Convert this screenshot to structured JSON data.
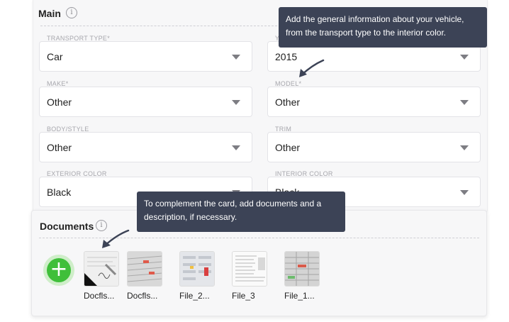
{
  "main": {
    "title": "Main",
    "fields": [
      {
        "label": "TRANSPORT TYPE*",
        "value": "Car"
      },
      {
        "label": "YEAR",
        "value": "2015"
      },
      {
        "label": "MAKE*",
        "value": "Other"
      },
      {
        "label": "MODEL*",
        "value": "Other"
      },
      {
        "label": "BODY/STYLE",
        "value": "Other"
      },
      {
        "label": "TRIM",
        "value": "Other"
      },
      {
        "label": "EXTERIOR COLOR",
        "value": "Black"
      },
      {
        "label": "INTERIOR COLOR",
        "value": "Black"
      }
    ]
  },
  "documents": {
    "title": "Documents",
    "files": [
      {
        "name": "Docfls...",
        "icon": "signature-document-thumbnail"
      },
      {
        "name": "Docfls...",
        "icon": "spreadsheet-document-thumbnail"
      },
      {
        "name": "File_2...",
        "icon": "table-document-thumbnail"
      },
      {
        "name": "File_3",
        "icon": "text-document-thumbnail"
      },
      {
        "name": "File_1...",
        "icon": "spreadsheet-document-thumbnail"
      }
    ]
  },
  "tooltips": {
    "main": "Add the general information about your vehicle, from the transport type to the interior color.",
    "documents": "To complement the card, add documents and a description, if necessary."
  },
  "colors": {
    "tooltip_bg": "#3c4356",
    "add_button": "#3fbf3a",
    "card_bg": "#f7f7f8"
  }
}
